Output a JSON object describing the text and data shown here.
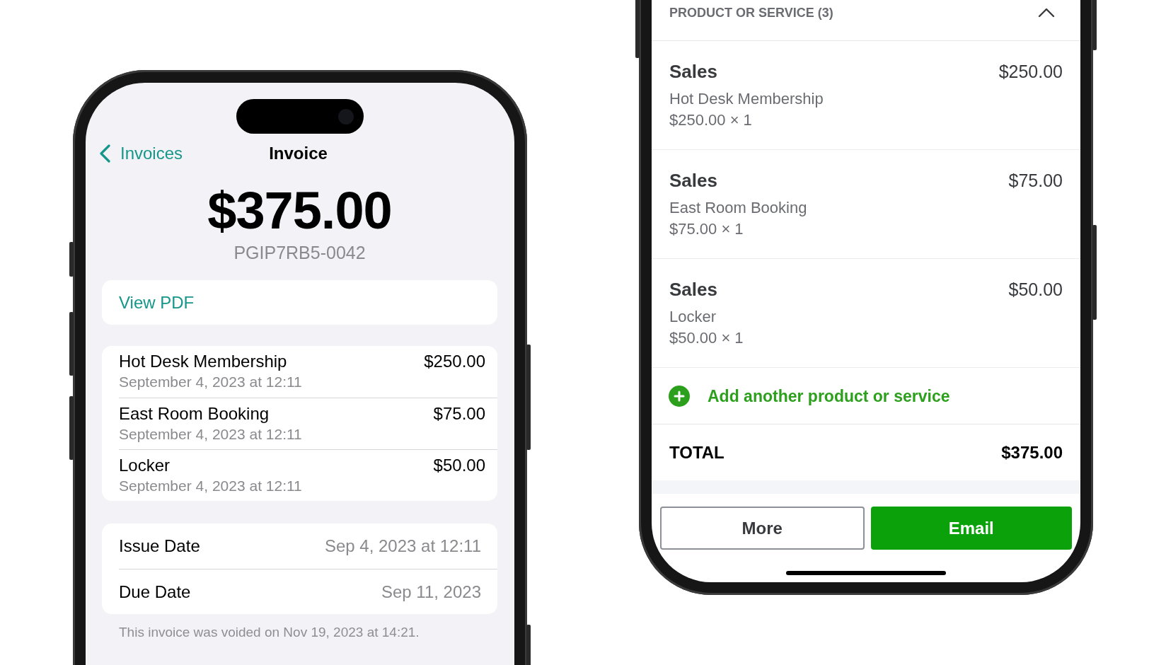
{
  "left_screen": {
    "nav": {
      "back_label": "Invoices",
      "title": "Invoice"
    },
    "amount": "$375.00",
    "invoice_number": "PGIP7RB5-0042",
    "view_pdf": "View PDF",
    "line_items": [
      {
        "name": "Hot Desk Membership",
        "date": "September 4, 2023 at 12:11",
        "amount": "$250.00"
      },
      {
        "name": "East Room Booking",
        "date": "September 4, 2023 at 12:11",
        "amount": "$75.00"
      },
      {
        "name": "Locker",
        "date": "September 4, 2023 at 12:11",
        "amount": "$50.00"
      }
    ],
    "dates": [
      {
        "label": "Issue Date",
        "value": "Sep 4, 2023 at 12:11"
      },
      {
        "label": "Due Date",
        "value": "Sep 11, 2023"
      }
    ],
    "void_note": "This invoice was voided on Nov 19, 2023 at 14:21."
  },
  "right_screen": {
    "section": {
      "title": "PRODUCT OR SERVICE (3)",
      "expanded": true
    },
    "products": [
      {
        "category": "Sales",
        "amount": "$250.00",
        "name": "Hot Desk Membership",
        "quantity_line": "$250.00 × 1"
      },
      {
        "category": "Sales",
        "amount": "$75.00",
        "name": "East Room Booking",
        "quantity_line": "$75.00 × 1"
      },
      {
        "category": "Sales",
        "amount": "$50.00",
        "name": "Locker",
        "quantity_line": "$50.00 × 1"
      }
    ],
    "add_link": "Add another product or service",
    "total": {
      "label": "TOTAL",
      "amount": "$375.00"
    },
    "buttons": [
      {
        "label": "More",
        "kind": "secondary"
      },
      {
        "label": "Email",
        "kind": "primary"
      }
    ]
  }
}
